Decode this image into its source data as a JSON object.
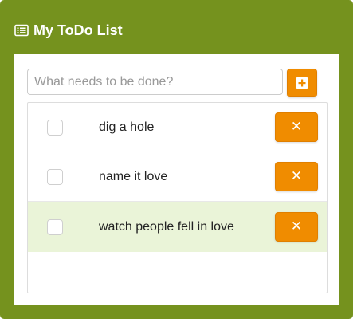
{
  "header": {
    "title": "My ToDo List",
    "icon": "list-icon"
  },
  "input": {
    "placeholder": "What needs to be done?",
    "value": ""
  },
  "add_button": {
    "icon": "plus-square-icon"
  },
  "todos": [
    {
      "text": "dig a hole",
      "done": false,
      "delete_glyph": "✕"
    },
    {
      "text": "name it love",
      "done": false,
      "delete_glyph": "✕"
    },
    {
      "text": "watch people fell in love",
      "done": false,
      "delete_glyph": "✕",
      "highlighted": true
    }
  ],
  "colors": {
    "panel": "#75921e",
    "accent": "#f08c00",
    "highlight_row": "#eaf4d8"
  }
}
